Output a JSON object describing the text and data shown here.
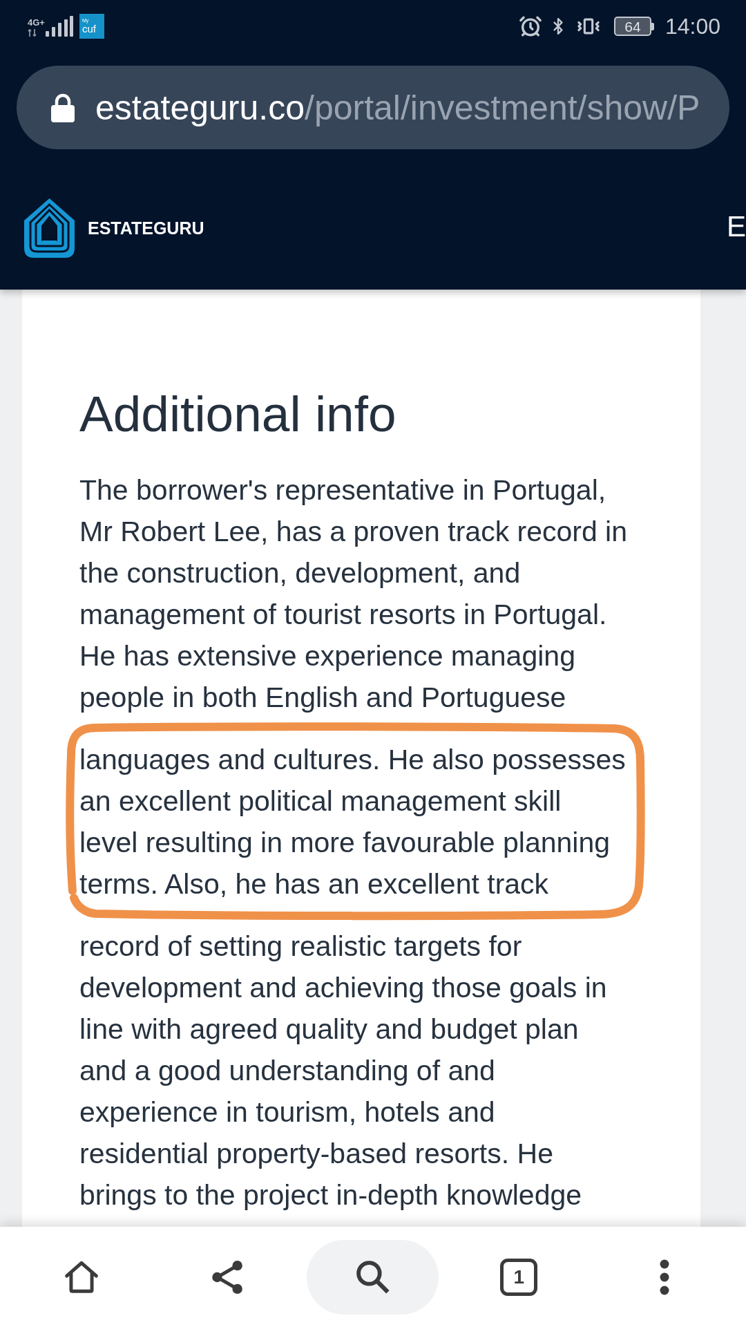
{
  "status_bar": {
    "network": "4G+",
    "app_icon": {
      "small_text": "My",
      "text": "cuf"
    },
    "battery": "64",
    "time": "14:00"
  },
  "address_bar": {
    "domain": "estateguru.co",
    "path": "/portal/investment/show/P"
  },
  "header": {
    "brand": "ESTATEGURU",
    "nav_link": "E"
  },
  "content": {
    "heading": "Additional info",
    "paragraph_blocks": [
      {
        "circled": false,
        "lines": [
          "The borrower's representative in Portugal,",
          "Mr Robert Lee, has a proven track record in",
          "the construction, development, and",
          "management of tourist resorts in Portugal.",
          "He has extensive experience managing",
          "people in both English and Portuguese"
        ]
      },
      {
        "circled": true,
        "lines": [
          "languages and cultures. He also possesses",
          "an excellent political management skill",
          "level resulting in more favourable planning",
          "terms. Also, he has an excellent track"
        ]
      },
      {
        "circled": false,
        "lines": [
          "record of setting realistic targets for",
          "development and achieving those goals in",
          "line with agreed quality and budget plan",
          "and a good understanding of and",
          "experience in tourism, hotels and",
          "residential property-based resorts. He",
          "brings to the project in-depth knowledge"
        ]
      }
    ]
  },
  "bottom_toolbar": {
    "tab_count": "1"
  }
}
